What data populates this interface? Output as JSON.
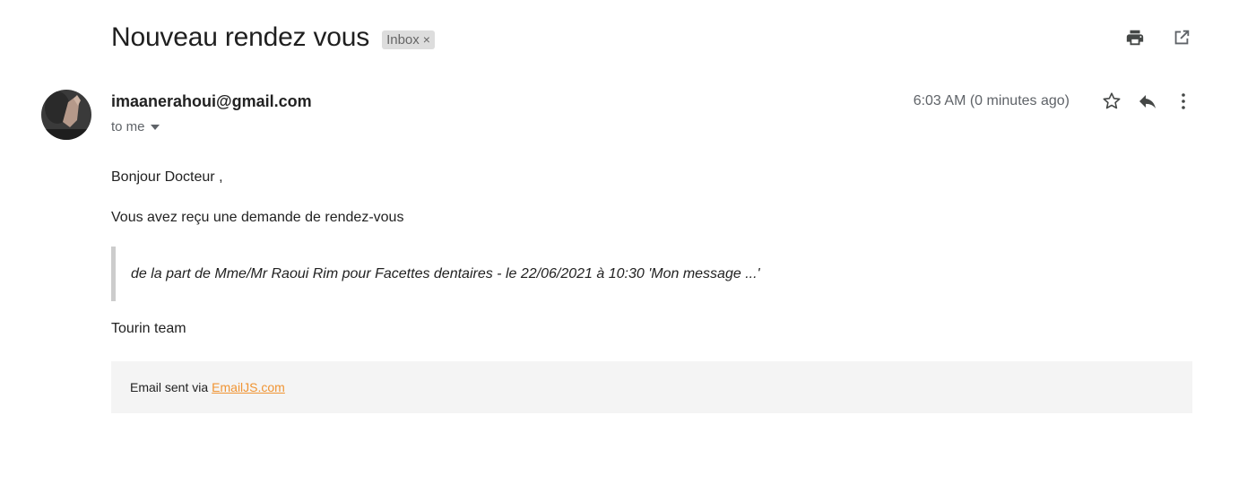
{
  "email": {
    "subject": "Nouveau rendez vous",
    "label": "Inbox",
    "label_remove": "×",
    "sender": "imaanerahoui@gmail.com",
    "recipient_text": "to me",
    "timestamp": "6:03 AM (0 minutes ago)",
    "body": {
      "greeting": "Bonjour Docteur ,",
      "intro": "Vous avez reçu une demande de rendez-vous",
      "quote": "de la part de Mme/Mr Raoui Rim pour Facettes dentaires - le 22/06/2021 à 10:30 'Mon message ...'",
      "signature": "Tourin team"
    },
    "footer": {
      "text": "Email sent via",
      "link_text": "EmailJS.com"
    }
  },
  "icons": {
    "print": "print-icon",
    "open_new_window": "open-in-new-window-icon",
    "star": "star-icon",
    "reply": "reply-icon",
    "more": "more-vertical-icon",
    "recipient_dropdown": "caret-down-icon"
  },
  "colors": {
    "link": "#f09433",
    "quote_border": "#cccccc",
    "footer_bg": "#f4f4f4",
    "label_chip_bg": "#dddddd"
  }
}
